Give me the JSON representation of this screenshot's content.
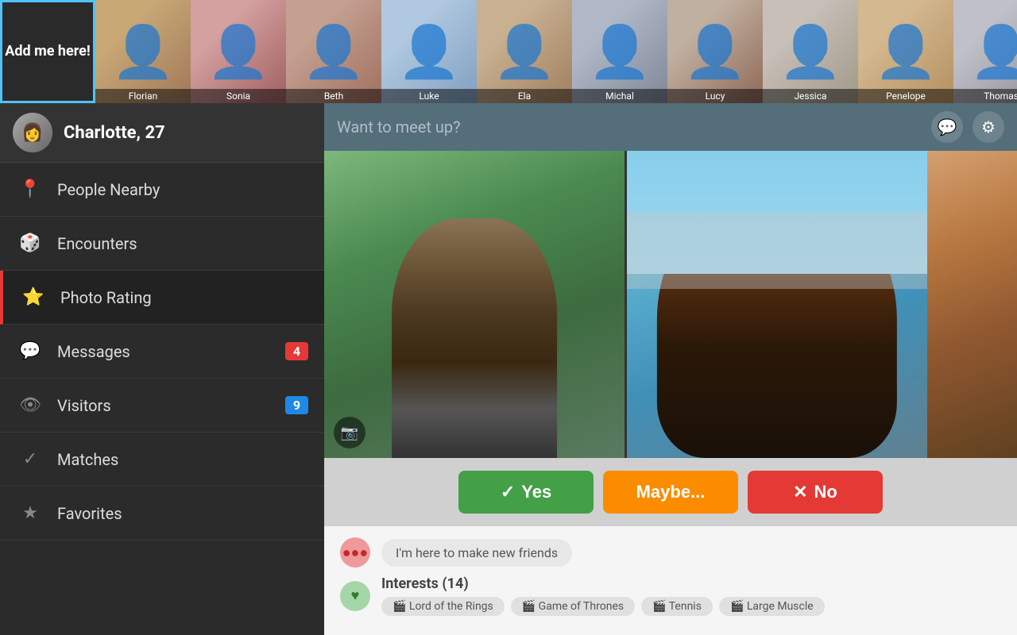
{
  "topBar": {
    "addMe": "Add me here!",
    "avatars": [
      {
        "name": "Florian",
        "colorClass": "av-florian"
      },
      {
        "name": "Sonia",
        "colorClass": "av-sonia"
      },
      {
        "name": "Beth",
        "colorClass": "av-beth"
      },
      {
        "name": "Luke",
        "colorClass": "av-luke"
      },
      {
        "name": "Ela",
        "colorClass": "av-ela"
      },
      {
        "name": "Michal",
        "colorClass": "av-michal"
      },
      {
        "name": "Lucy",
        "colorClass": "av-lucy"
      },
      {
        "name": "Jessica",
        "colorClass": "av-jessica"
      },
      {
        "name": "Penelope",
        "colorClass": "av-penelope"
      },
      {
        "name": "Thomas",
        "colorClass": "av-thomas"
      }
    ]
  },
  "sidebar": {
    "profile": {
      "name": "Charlotte, 27"
    },
    "navItems": [
      {
        "id": "people-nearby",
        "label": "People Nearby",
        "icon": "📍",
        "badge": null,
        "badgeType": null,
        "active": false
      },
      {
        "id": "encounters",
        "label": "Encounters",
        "icon": "🎲",
        "badge": null,
        "badgeType": null,
        "active": false
      },
      {
        "id": "photo-rating",
        "label": "Photo Rating",
        "icon": "⭐",
        "badge": null,
        "badgeType": null,
        "active": true
      },
      {
        "id": "messages",
        "label": "Messages",
        "icon": "💬",
        "badge": "4",
        "badgeType": "badge-red",
        "active": false
      },
      {
        "id": "visitors",
        "label": "Visitors",
        "icon": "👁",
        "badge": "9",
        "badgeType": "badge-blue",
        "active": false
      },
      {
        "id": "matches",
        "label": "Matches",
        "icon": "✓",
        "badge": null,
        "badgeType": null,
        "active": false
      },
      {
        "id": "favorites",
        "label": "Favorites",
        "icon": "★",
        "badge": null,
        "badgeType": null,
        "active": false
      }
    ]
  },
  "content": {
    "header": {
      "placeholder": "Want to meet up?",
      "chatIcon": "💬",
      "settingsIcon": "⚙"
    },
    "buttons": {
      "yes": "Yes",
      "maybe": "Maybe...",
      "no": "No"
    },
    "profileInfo": {
      "statusText": "I'm here to make new friends",
      "interests": {
        "label": "Interests (14)",
        "count": 14,
        "tags": [
          "Lord of the Rings",
          "Game of Thrones",
          "Tennis",
          "Large Muscle"
        ]
      }
    }
  }
}
